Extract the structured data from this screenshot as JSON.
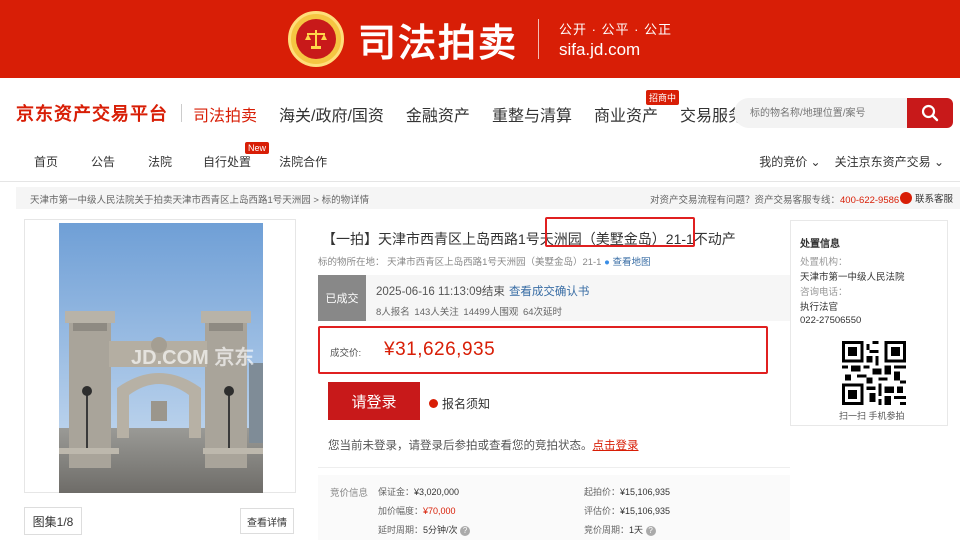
{
  "banner": {
    "title": "司法拍卖",
    "slogan": "公开 · 公平 · 公正",
    "url": "sifa.jd.com"
  },
  "mainnav": {
    "logo": "京东资产交易平台",
    "items": [
      {
        "label": "司法拍卖"
      },
      {
        "label": "海关/政府/国资"
      },
      {
        "label": "金融资产"
      },
      {
        "label": "重整与清算"
      },
      {
        "label": "商业资产",
        "badge": "招商中"
      },
      {
        "label": "交易服务"
      }
    ],
    "search_placeholder": "标的物名称/地理位置/案号"
  },
  "subnav": {
    "items": [
      {
        "label": "首页"
      },
      {
        "label": "公告"
      },
      {
        "label": "法院"
      },
      {
        "label": "自行处置",
        "badge": "New"
      },
      {
        "label": "法院合作"
      }
    ],
    "my_bids": "我的竞价 ⌄",
    "follow": "关注京东资产交易 ⌄"
  },
  "breadcrumb": {
    "path": "天津市第一中级人民法院关于拍卖天津市西青区上岛西路1号天洲园 > 标的物详情",
    "help": "对资产交易流程有问题？资产交易客服专线：",
    "phone": "400-622-9586",
    "contact": "联系客服"
  },
  "gallery": {
    "watermark": "JD.COM 京东",
    "counter": "图集1/8",
    "detail": "查看详情"
  },
  "item": {
    "title": "【一拍】天津市西青区上岛西路1号天洲园（美墅金岛）21-1不动产",
    "location_label": "标的物所在地：",
    "location": "天津市西青区上岛西路1号天洲园（美墅金岛）21-1",
    "map_link": "查看地图",
    "status": "已成交",
    "end_time": "2025-06-16 11:13:09结束",
    "confirm_link": "查看成交确认书",
    "stats": "8人报名 143人关注 14499人围观 64次延时",
    "deal_label": "成交价:",
    "deal_price": "¥31,626,935",
    "login_button": "请登录",
    "notice": "报名须知",
    "login_tip": "您当前未登录，请登录后参拍或查看您的竞拍状态。",
    "login_link": "点击登录"
  },
  "bid_info": {
    "heading": "竞价信息",
    "deposit_label": "保证金：",
    "deposit": "¥3,020,000",
    "start_label": "起拍价：",
    "start": "¥15,106,935",
    "increment_label": "加价幅度：",
    "increment": "¥70,000",
    "appraisal_label": "评估价：",
    "appraisal": "¥15,106,935",
    "delay_label": "延时周期：",
    "delay": "5分钟/次",
    "cycle_label": "竞价周期：",
    "cycle": "1天"
  },
  "side": {
    "title": "处置信息",
    "org_label": "处置机构：",
    "org": "天津市第一中级人民法院",
    "consult_label": "咨询电话：",
    "contact": "执行法官",
    "phone": "022-27506550",
    "qr_caption": "扫一扫 手机参拍"
  },
  "colors": {
    "brand_red": "#d81e06",
    "button_red": "#c8191a",
    "highlight_border": "#e02020",
    "link_blue": "#3a6ea5"
  }
}
